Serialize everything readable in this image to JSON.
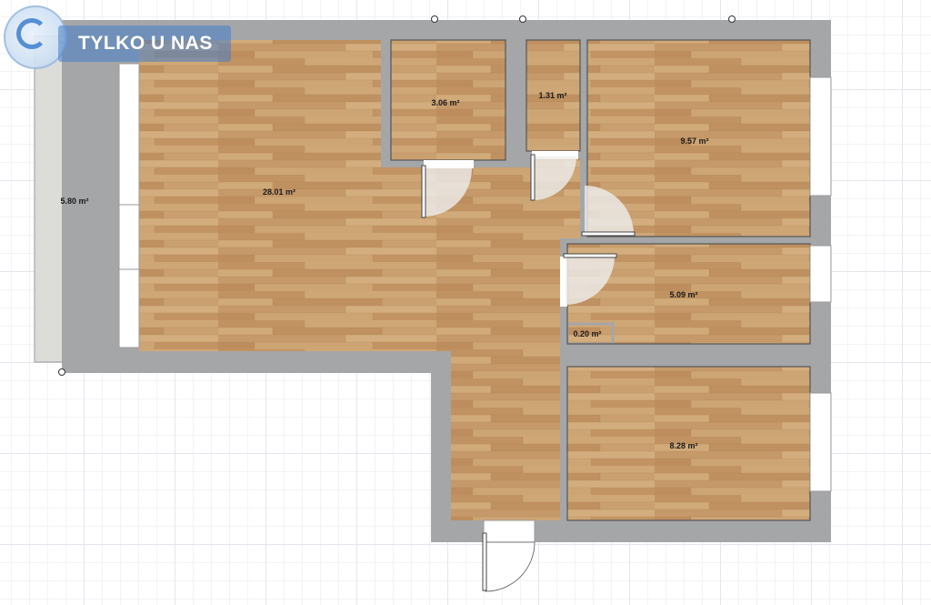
{
  "logo": {
    "text": "TYLKO U NAS"
  },
  "colors": {
    "wall": "#a5a6a8",
    "floor": "#c79c6a",
    "balcony": "#dcdcd9",
    "door_fill": "#eeeeee",
    "logo_banner": "#467dc8"
  },
  "rooms": [
    {
      "label": "28.01 m²"
    },
    {
      "label": "3.06 m²"
    },
    {
      "label": "1.31 m²"
    },
    {
      "label": "9.57 m²"
    },
    {
      "label": "5.09 m²"
    },
    {
      "label": "0.20 m²"
    },
    {
      "label": "8.28 m²"
    },
    {
      "label": "5.80 m²"
    }
  ]
}
